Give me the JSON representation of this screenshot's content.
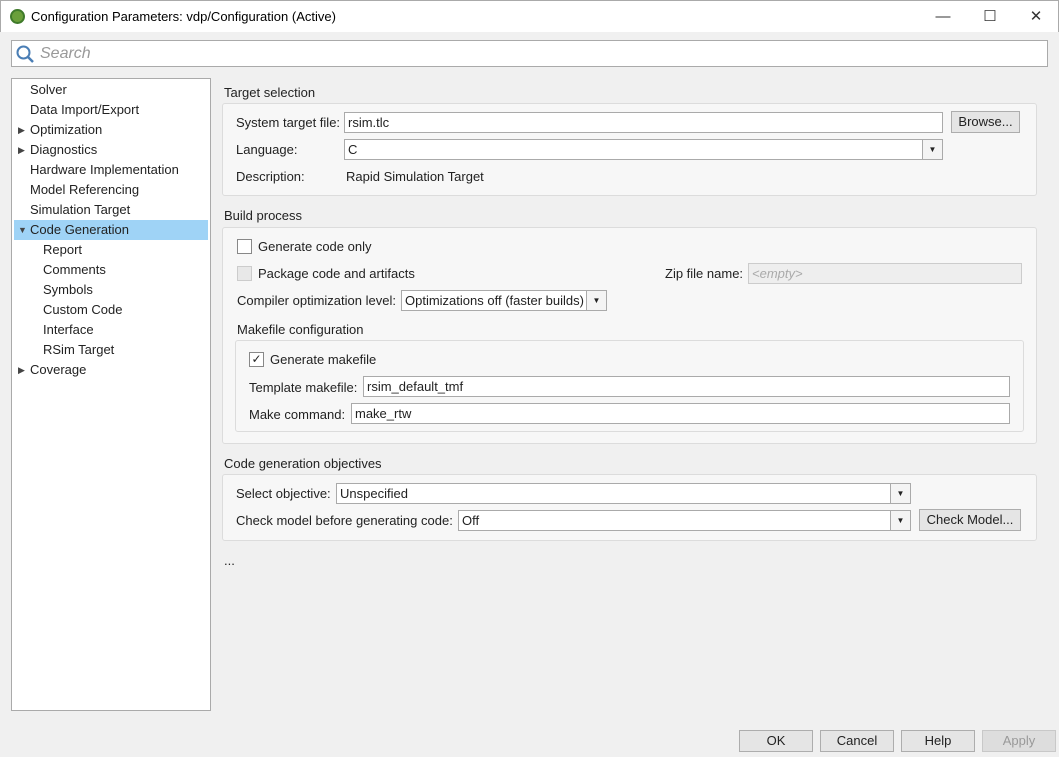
{
  "window": {
    "title": "Configuration Parameters: vdp/Configuration (Active)",
    "minimize": "—",
    "maximize": "☐",
    "close": "✕"
  },
  "search": {
    "placeholder": "Search"
  },
  "tree": {
    "items": [
      {
        "label": "Solver"
      },
      {
        "label": "Data Import/Export"
      },
      {
        "label": "Optimization"
      },
      {
        "label": "Diagnostics"
      },
      {
        "label": "Hardware Implementation"
      },
      {
        "label": "Model Referencing"
      },
      {
        "label": "Simulation Target"
      },
      {
        "label": "Code Generation"
      },
      {
        "label": "Report"
      },
      {
        "label": "Comments"
      },
      {
        "label": "Symbols"
      },
      {
        "label": "Custom Code"
      },
      {
        "label": "Interface"
      },
      {
        "label": "RSim Target"
      },
      {
        "label": "Coverage"
      }
    ]
  },
  "target": {
    "heading": "Target selection",
    "stf_label": "System target file:",
    "stf_value": "rsim.tlc",
    "browse": "Browse...",
    "lang_label": "Language:",
    "lang_value": "C",
    "desc_label": "Description:",
    "desc_value": "Rapid Simulation Target"
  },
  "build": {
    "heading": "Build process",
    "gen_code_only": "Generate code only",
    "package": "Package code and artifacts",
    "zip_label": "Zip file name:",
    "zip_placeholder": "<empty>",
    "opt_label": "Compiler optimization level:",
    "opt_value": "Optimizations off (faster builds)",
    "makefile": {
      "heading": "Makefile configuration",
      "gen_makefile": "Generate makefile",
      "check": "✓",
      "tmf_label": "Template makefile:",
      "tmf_value": "rsim_default_tmf",
      "make_label": "Make command:",
      "make_value": "make_rtw"
    }
  },
  "objectives": {
    "heading": "Code generation objectives",
    "select_label": "Select objective:",
    "select_value": "Unspecified",
    "check_label": "Check model before generating code:",
    "check_value": "Off",
    "check_button": "Check Model..."
  },
  "ellipsis": "...",
  "buttons": {
    "ok": "OK",
    "cancel": "Cancel",
    "help": "Help",
    "apply": "Apply"
  }
}
